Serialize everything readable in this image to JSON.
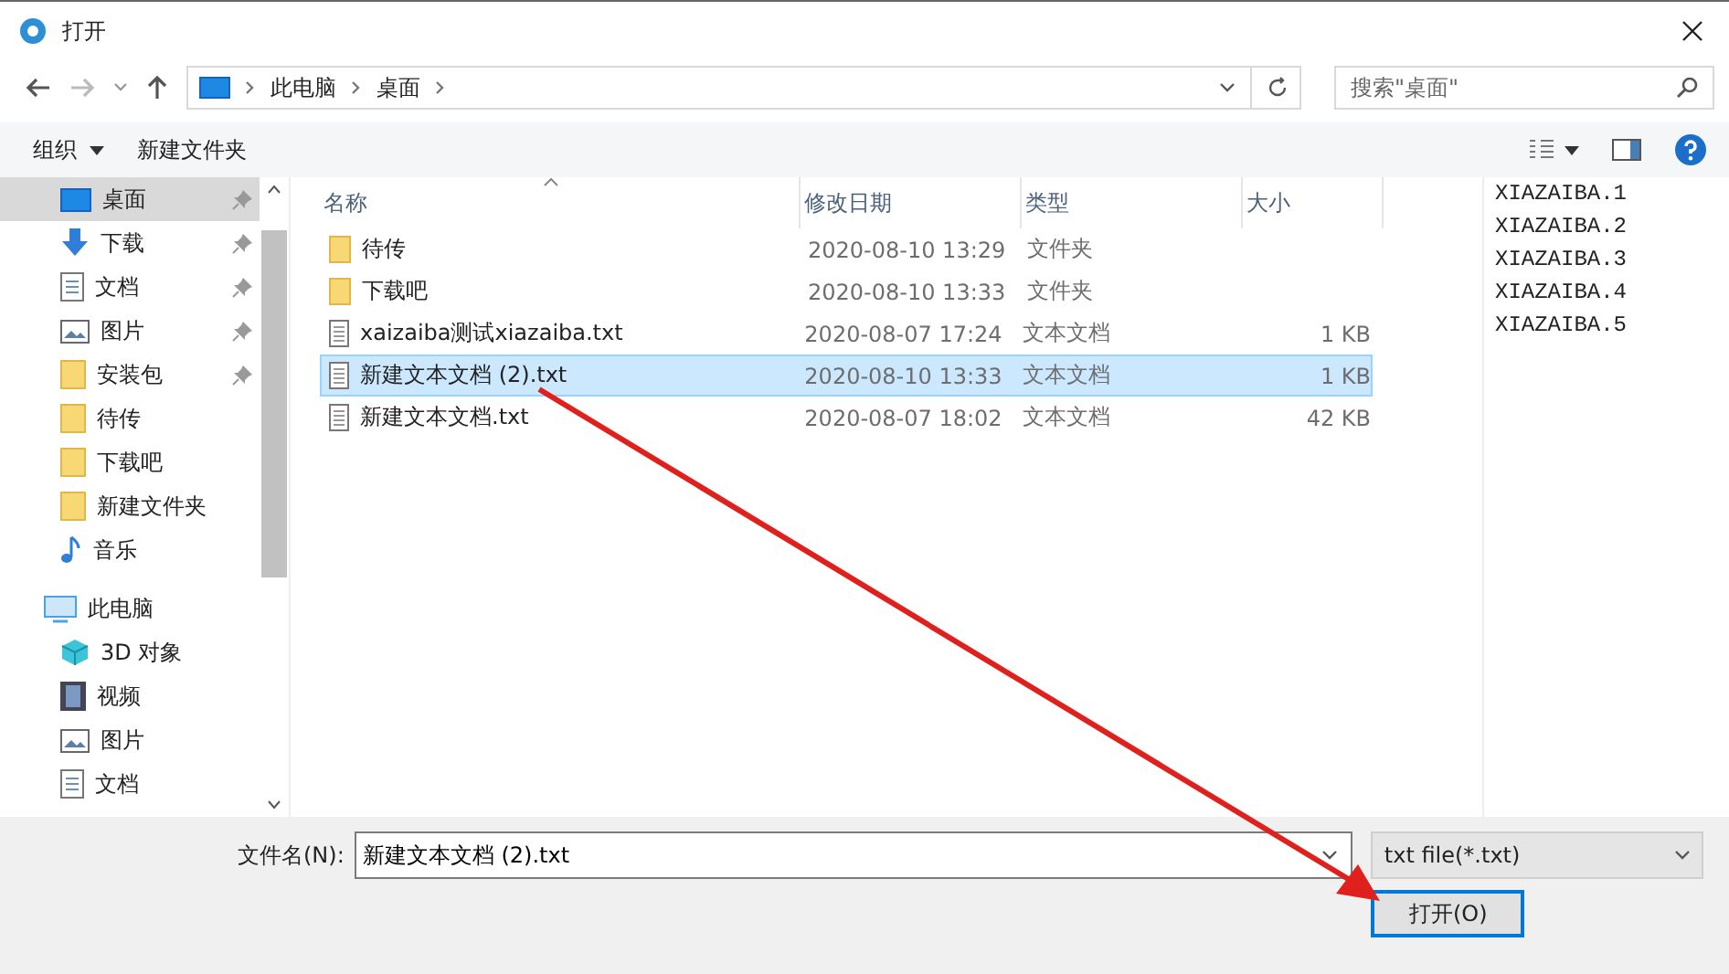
{
  "window": {
    "title": "打开"
  },
  "address": {
    "crumbs": [
      "此电脑",
      "桌面"
    ]
  },
  "search": {
    "placeholder": "搜索\"桌面\""
  },
  "toolbar": {
    "organize": "组织",
    "new_folder": "新建文件夹"
  },
  "sidebar": {
    "items": [
      {
        "label": "桌面",
        "kind": "desktop",
        "pinned": true,
        "selected": true
      },
      {
        "label": "下载",
        "kind": "download",
        "pinned": true,
        "selected": false
      },
      {
        "label": "文档",
        "kind": "doc",
        "pinned": true,
        "selected": false
      },
      {
        "label": "图片",
        "kind": "picture",
        "pinned": true,
        "selected": false
      },
      {
        "label": "安装包",
        "kind": "folder",
        "pinned": true,
        "selected": false
      },
      {
        "label": "待传",
        "kind": "folder",
        "pinned": false,
        "selected": false
      },
      {
        "label": "下载吧",
        "kind": "folder",
        "pinned": false,
        "selected": false
      },
      {
        "label": "新建文件夹",
        "kind": "folder",
        "pinned": false,
        "selected": false
      },
      {
        "label": "音乐",
        "kind": "music",
        "pinned": false,
        "selected": false
      },
      {
        "label": "此电脑",
        "kind": "pc",
        "pinned": false,
        "selected": false,
        "children": [
          {
            "label": "3D 对象",
            "kind": "cube",
            "pinned": false,
            "selected": false
          },
          {
            "label": "视频",
            "kind": "video",
            "pinned": false,
            "selected": false
          },
          {
            "label": "图片",
            "kind": "picture",
            "pinned": false,
            "selected": false
          },
          {
            "label": "文档",
            "kind": "doc",
            "pinned": false,
            "selected": false
          }
        ]
      }
    ]
  },
  "table": {
    "columns": [
      "名称",
      "修改日期",
      "类型",
      "大小"
    ],
    "rows": [
      {
        "name": "待传",
        "date": "2020-08-10 13:29",
        "type": "文件夹",
        "kind": "folder",
        "selected": false
      },
      {
        "name": "下载吧",
        "date": "2020-08-10 13:33",
        "type": "文件夹",
        "kind": "folder",
        "selected": false
      },
      {
        "name": "xaizaiba测试xiazaiba.txt",
        "date": "2020-08-07 17:24",
        "type": "文本文档",
        "size": "1 KB",
        "kind": "text",
        "selected": false
      },
      {
        "name": "新建文本文档 (2).txt",
        "date": "2020-08-10 13:33",
        "type": "文本文档",
        "size": "1 KB",
        "kind": "text",
        "selected": true
      },
      {
        "name": "新建文本文档.txt",
        "date": "2020-08-07 18:02",
        "type": "文本文档",
        "size": "42 KB",
        "kind": "text",
        "selected": false
      }
    ]
  },
  "preview": {
    "lines": [
      "XIAZAIBA.1",
      "XIAZAIBA.2",
      "XIAZAIBA.3",
      "XIAZAIBA.4",
      "XIAZAIBA.5"
    ]
  },
  "footer": {
    "filename_label": "文件名(N):",
    "filename": "新建文本文档 (2).txt",
    "filetype": "txt file(*.txt)",
    "open_button": "打开(O)"
  }
}
